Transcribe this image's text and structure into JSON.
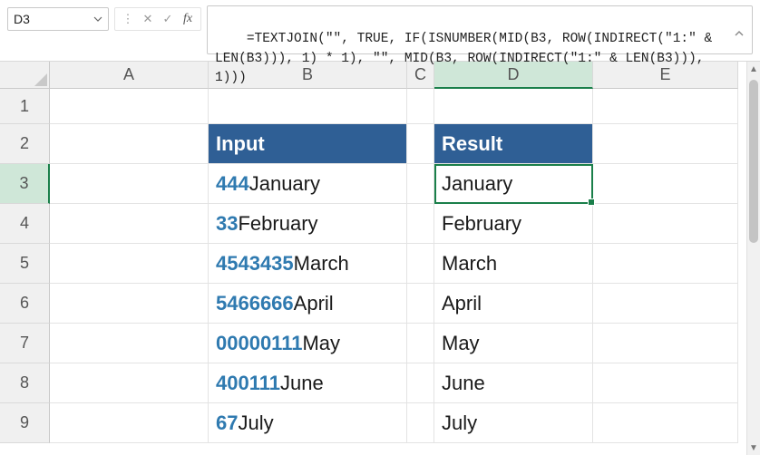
{
  "formula_bar": {
    "cell_ref": "D3",
    "formula": "=TEXTJOIN(\"\", TRUE, IF(ISNUMBER(MID(B3, ROW(INDIRECT(\"1:\" & LEN(B3))), 1) * 1), \"\", MID(B3, ROW(INDIRECT(\"1:\" & LEN(B3))), 1)))"
  },
  "columns": [
    "A",
    "B",
    "C",
    "D",
    "E"
  ],
  "rows": [
    "1",
    "2",
    "3",
    "4",
    "5",
    "6",
    "7",
    "8",
    "9"
  ],
  "active_cell": "D3",
  "headers": {
    "B": "Input",
    "D": "Result"
  },
  "data": [
    {
      "num": "444",
      "text": "January",
      "result": "January"
    },
    {
      "num": "33",
      "text": "February",
      "result": "February"
    },
    {
      "num": "4543435",
      "text": "March",
      "result": "March"
    },
    {
      "num": "5466666",
      "text": "April",
      "result": "April"
    },
    {
      "num": "00000111",
      "text": "May",
      "result": "May"
    },
    {
      "num": "400111",
      "text": "June",
      "result": "June"
    },
    {
      "num": "67",
      "text": "July",
      "result": "July"
    }
  ],
  "colors": {
    "header_bg": "#2f5f95",
    "num_color": "#2f7ab0",
    "selection": "#1a7f4a"
  }
}
